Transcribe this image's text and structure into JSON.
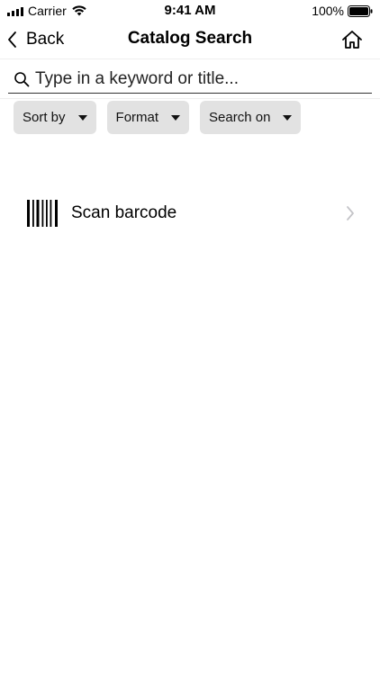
{
  "status": {
    "carrier": "Carrier",
    "time": "9:41 AM",
    "battery": "100%"
  },
  "nav": {
    "back_label": "Back",
    "title": "Catalog Search"
  },
  "search": {
    "placeholder": "Type in a keyword or title...",
    "value": ""
  },
  "filters": [
    {
      "label": "Sort by"
    },
    {
      "label": "Format"
    },
    {
      "label": "Search on"
    }
  ],
  "scan": {
    "label": "Scan barcode"
  },
  "icons": {
    "signal": "signal-bars-icon",
    "wifi": "wifi-icon",
    "battery": "battery-icon",
    "back": "chevron-left-icon",
    "home": "home-icon",
    "search": "search-icon",
    "barcode": "barcode-icon",
    "disclosure": "chevron-right-icon"
  }
}
